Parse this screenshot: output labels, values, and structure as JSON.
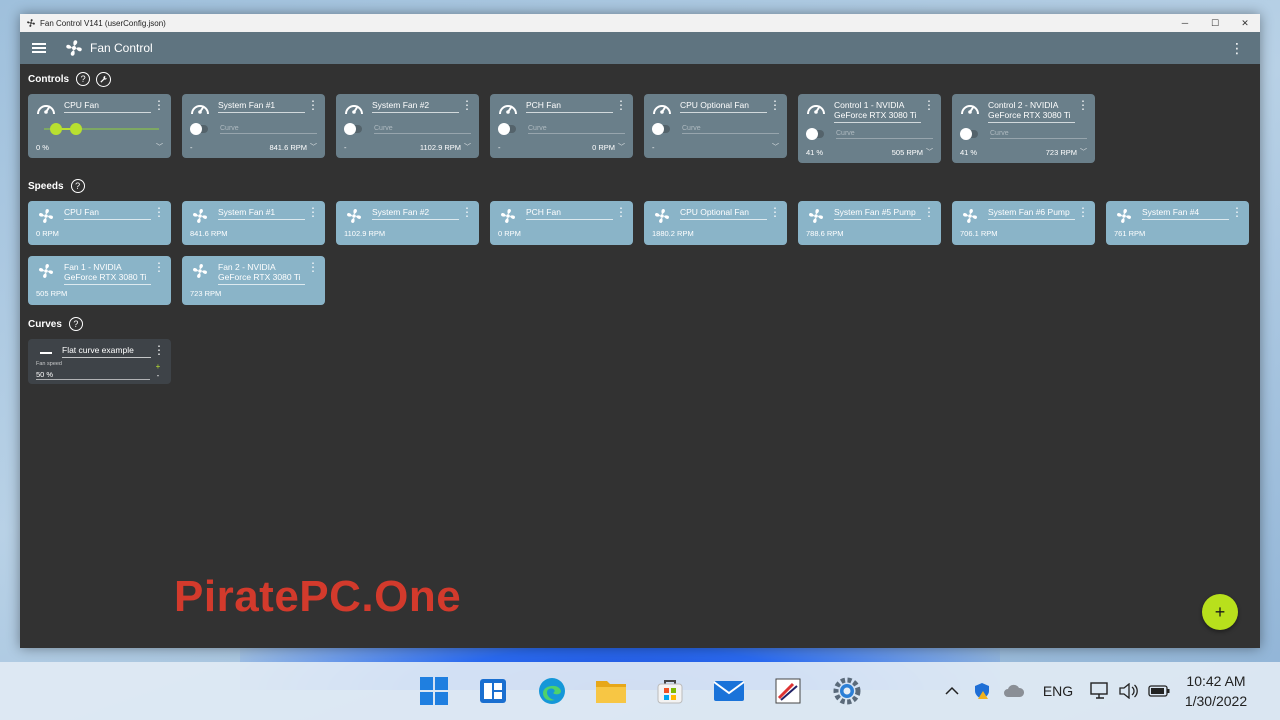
{
  "window": {
    "title": "Fan Control V141 (userConfig.json)",
    "minimize": "─",
    "maximize": "☐",
    "close": "✕"
  },
  "appbar": {
    "title": "Fan Control"
  },
  "sections": {
    "controls": "Controls",
    "speeds": "Speeds",
    "curves": "Curves",
    "help": "?"
  },
  "controls": [
    {
      "name": "CPU Fan",
      "value": "0 %",
      "type": "slider",
      "slider_value_percent": 0
    },
    {
      "name": "System Fan #1",
      "curve": "Curve",
      "value": "-",
      "rpm": "841.6 RPM"
    },
    {
      "name": "System Fan #2",
      "curve": "Curve",
      "value": "-",
      "rpm": "1102.9 RPM"
    },
    {
      "name": "PCH Fan",
      "curve": "Curve",
      "value": "-",
      "rpm": "0 RPM"
    },
    {
      "name": "CPU Optional Fan",
      "curve": "Curve",
      "value": "-",
      "rpm": ""
    },
    {
      "name": "Control 1 - NVIDIA GeForce RTX 3080 Ti",
      "curve": "Curve",
      "value": "41 %",
      "rpm": "505 RPM"
    },
    {
      "name": "Control 2 - NVIDIA GeForce RTX 3080 Ti",
      "curve": "Curve",
      "value": "41 %",
      "rpm": "723 RPM"
    }
  ],
  "speeds": [
    {
      "name": "CPU Fan",
      "rpm": "0 RPM"
    },
    {
      "name": "System Fan #1",
      "rpm": "841.6 RPM"
    },
    {
      "name": "System Fan #2",
      "rpm": "1102.9 RPM"
    },
    {
      "name": "PCH Fan",
      "rpm": "0 RPM"
    },
    {
      "name": "CPU Optional Fan",
      "rpm": "1880.2 RPM"
    },
    {
      "name": "System Fan #5 Pump",
      "rpm": "788.6 RPM"
    },
    {
      "name": "System Fan #6 Pump",
      "rpm": "706.1 RPM"
    },
    {
      "name": "System Fan #4",
      "rpm": "761 RPM"
    },
    {
      "name": "Fan 1 - NVIDIA GeForce RTX 3080 Ti",
      "rpm": "505 RPM"
    },
    {
      "name": "Fan 2 - NVIDIA GeForce RTX 3080 Ti",
      "rpm": "723 RPM"
    }
  ],
  "curves": [
    {
      "name": "Flat curve example",
      "field_label": "Fan speed",
      "value": "50 %",
      "plus": "+",
      "minus": "-"
    }
  ],
  "watermark": "PiratePC.One",
  "fab": "+",
  "taskbar": {
    "apps": [
      "start-icon",
      "widgets-icon",
      "edge-icon",
      "file-explorer-icon",
      "store-icon",
      "mail-icon",
      "paint-icon",
      "settings-icon"
    ],
    "language": "ENG",
    "time": "10:42 AM",
    "date": "1/30/2022"
  },
  "colors": {
    "accent": "#b8e01c",
    "appbar": "#5f7480",
    "background": "#323232",
    "watermark": "#d33a2c"
  }
}
